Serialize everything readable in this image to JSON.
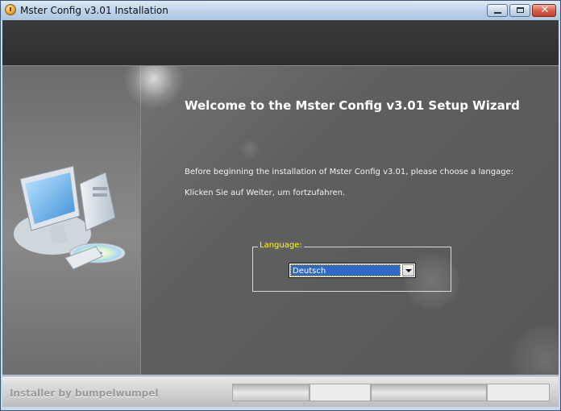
{
  "window": {
    "title": "Mster Config v3.01 Installation",
    "title_icon": "installer-app-icon",
    "controls": [
      "minimize-icon",
      "maximize-icon",
      "close-icon"
    ]
  },
  "wizard": {
    "heading": "Welcome to the Mster Config v3.01 Setup Wizard",
    "intro_text": "Before beginning the installation of Mster Config v3.01, please choose a langage:",
    "continue_text": "Klicken Sie auf Weiter, um fortzufahren.",
    "side_image": "computer-with-cd-illustration"
  },
  "language": {
    "group_label": "Language:",
    "selected": "Deutsch"
  },
  "footer": {
    "branding": "Installer by bumpelwumpel"
  },
  "colors": {
    "group_label": "#ffff00",
    "selection_highlight": "#316ac5",
    "header_band": "#333333"
  }
}
